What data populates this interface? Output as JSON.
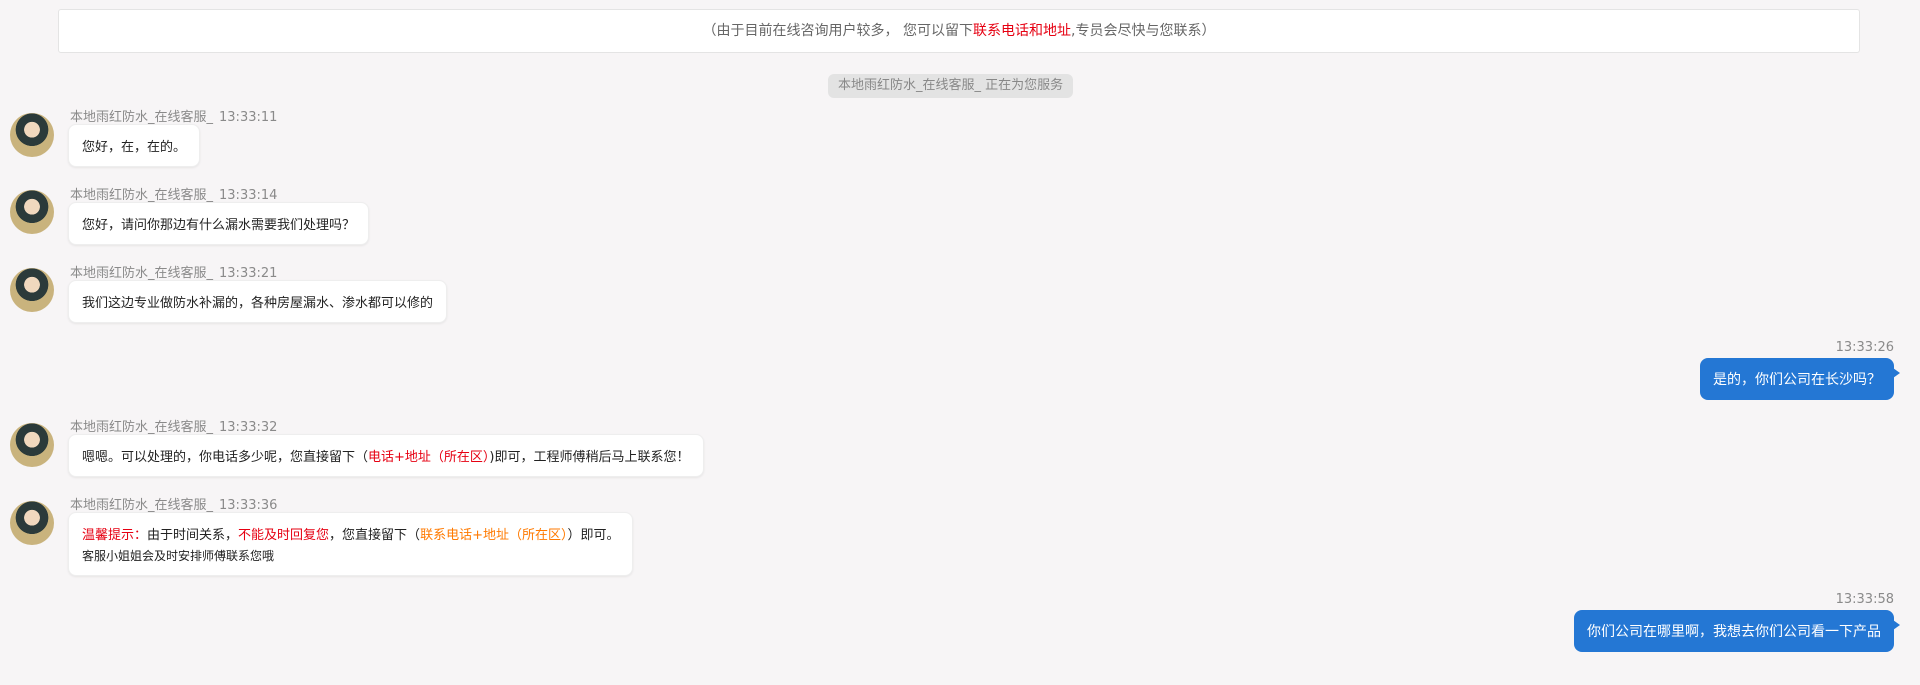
{
  "notice": {
    "prefix": "（由于目前在线咨询用户较多， 您可以留下",
    "highlight": "联系电话和地址",
    "suffix": ",专员会尽快与您联系）"
  },
  "system_message": "本地雨红防水_在线客服_ 正在为您服务",
  "agent_name": "本地雨红防水_在线客服_",
  "messages": [
    {
      "time": "13:33:11",
      "text": "您好，在，在的。"
    },
    {
      "time": "13:33:14",
      "text": "您好，请问你那边有什么漏水需要我们处理吗？"
    },
    {
      "time": "13:33:21",
      "text": "我们这边专业做防水补漏的，各种房屋漏水、渗水都可以修的"
    },
    {
      "time": "13:33:32",
      "text_a": "嗯嗯。可以处理的，你电话多少呢，您直接留下（",
      "text_red": "电话+地址（所在区）",
      "text_b": ")即可，工程师傅稍后马上联系您！"
    },
    {
      "time": "13:33:36",
      "tip_label": "温馨提示：",
      "tip_a": "由于时间关系，",
      "tip_red": "不能及时回复您",
      "tip_b": "，您直接留下（",
      "tip_orange": "联系电话+地址（所在区）",
      "tip_c": "）即可。",
      "tip_line2": "客服小姐姐会及时安排师傅联系您哦"
    }
  ],
  "user_messages": [
    {
      "time": "13:33:26",
      "text": "是的，你们公司在长沙吗？"
    },
    {
      "time": "13:33:58",
      "text": "你们公司在哪里啊，我想去你们公司看一下产品"
    }
  ]
}
